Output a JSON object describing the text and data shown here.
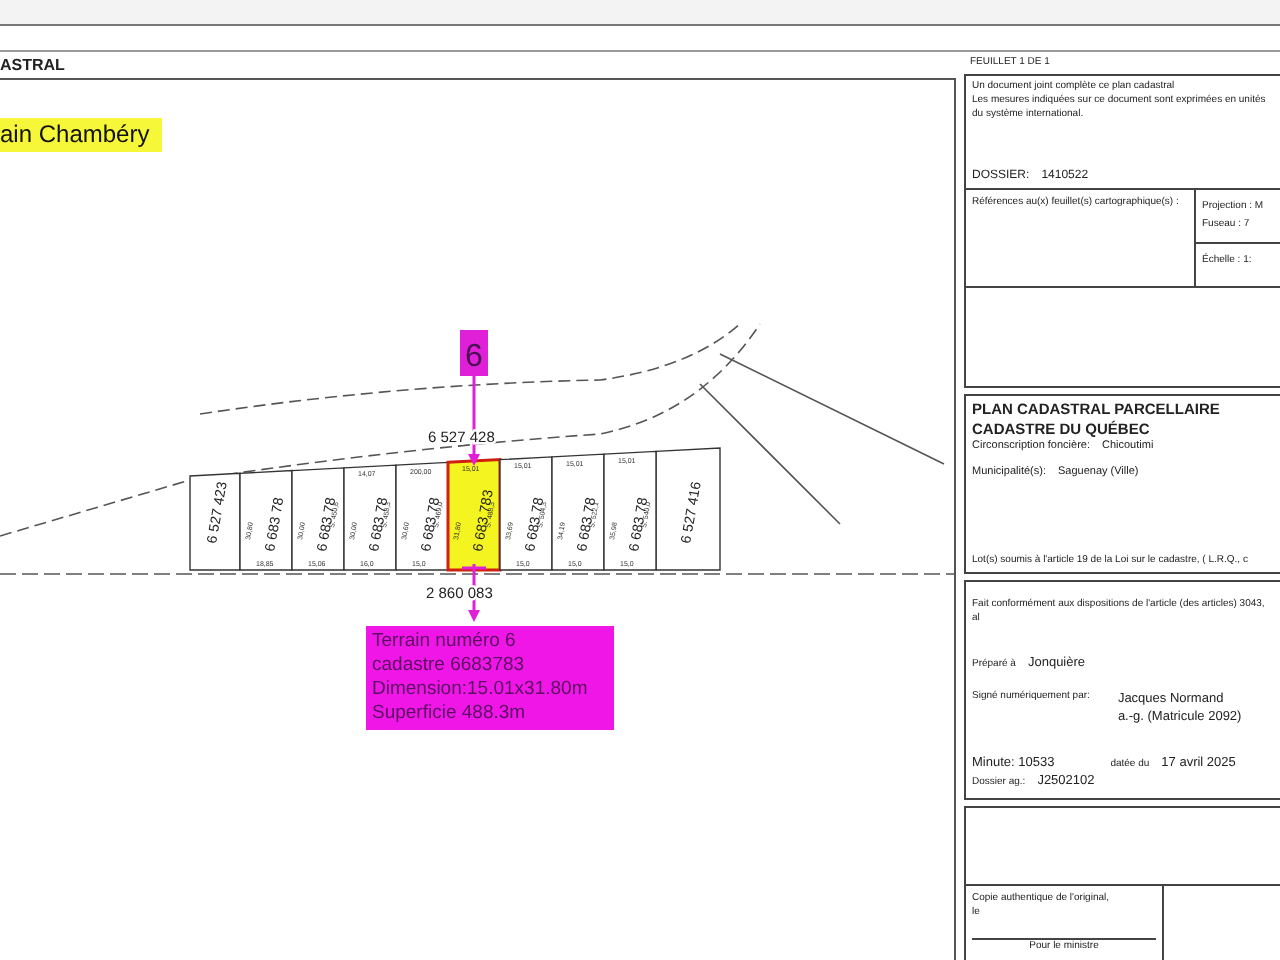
{
  "header": {
    "title": "ASTRAL"
  },
  "plan": {
    "project_label": "ain Chambéry",
    "edge_lots": [
      {
        "number": "6 527 423"
      },
      {
        "number": "6 527 416"
      }
    ],
    "street_lot": "6 527 428",
    "rear_lot": "2 860 083",
    "lots": [
      {
        "number": "6 683 78",
        "depth": "30,80",
        "rear": "18,85",
        "selected": false
      },
      {
        "number": "6 683 78",
        "depth": "30,00",
        "area": "S: 450,6",
        "rear": "15,06",
        "selected": false
      },
      {
        "number": "6 683 78",
        "front": "14,07",
        "depth": "30,00",
        "area": "S: 458,3",
        "rear": "16,0",
        "selected": false
      },
      {
        "number": "6 683 78",
        "front": "200,00",
        "depth": "30,60",
        "area": "S: 469,0",
        "rear": "15,0",
        "selected": false
      },
      {
        "number": "6 683 783",
        "front": "15,01",
        "depth": "31,80",
        "area": "S: 488,3",
        "selected": true
      },
      {
        "number": "6 683 78",
        "front": "15,01",
        "depth": "33,69",
        "area": "S: 504,3",
        "rear": "15,0",
        "selected": false
      },
      {
        "number": "6 683 78",
        "front": "15,01",
        "depth": "34,19",
        "area": "S: 522,1",
        "rear": "15,0",
        "selected": false
      },
      {
        "number": "6 683 78",
        "front": "15,01",
        "depth": "35,98",
        "area": "S: 540,0",
        "rear": "15,0",
        "selected": false
      }
    ],
    "marker": {
      "label": "6"
    },
    "info_box": {
      "lines": [
        "Terrain numéro 6",
        "cadastre 6683783",
        "Dimension:15.01x31.80m",
        "Superficie 488.3m"
      ]
    }
  },
  "panel": {
    "sheet": "FEUILLET 1 DE 1",
    "notes": [
      "Un document joint complète ce plan cadastral",
      "Les mesures indiquées sur ce document sont exprimées en unités du système international."
    ],
    "dossier": {
      "label": "DOSSIER:",
      "value": "1410522"
    },
    "references": {
      "label": "Références au(x) feuillet(s) cartographique(s) :",
      "projection": "Projection : M",
      "fuseau": "Fuseau : 7",
      "echelle": "Échelle : 1:"
    },
    "title": {
      "lines": [
        "PLAN CADASTRAL PARCELLAIRE",
        "CADASTRE DU QUÉBEC"
      ],
      "circonscription": {
        "label": "Circonscription foncière:",
        "value": "Chicoutimi"
      },
      "municipalite": {
        "label": "Municipalité(s):",
        "value": "Saguenay (Ville)"
      },
      "lots_note": "Lot(s) soumis à l'article 19 de la Loi sur le cadastre, ( L.R.Q., c"
    },
    "certification": {
      "statement": "Fait conformément aux dispositions de l'article (des articles) 3043, al",
      "prepared": {
        "label": "Préparé à",
        "value": "Jonquière"
      },
      "signed": {
        "label": "Signé numériquement par:",
        "lines": [
          "Jacques Normand",
          "a.-g. (Matricule 2092)"
        ]
      },
      "minute": "Minute: 10533",
      "date": {
        "label": "datée du",
        "value": "17 avril 2025"
      },
      "dossier_ag": {
        "label": "Dossier ag.:",
        "value": "J2502102"
      }
    },
    "copy": {
      "line": "Copie authentique de l'original,",
      "date_label": "le",
      "signature": "Pour le ministre"
    }
  }
}
